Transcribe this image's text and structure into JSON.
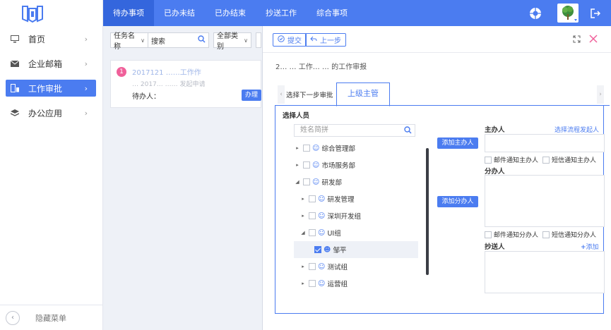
{
  "sidebar": {
    "items": [
      {
        "label": "首页",
        "icon": "monitor-icon"
      },
      {
        "label": "企业邮箱",
        "icon": "mail-icon"
      },
      {
        "label": "工作审批",
        "icon": "approval-icon"
      },
      {
        "label": "办公应用",
        "icon": "layers-icon"
      }
    ],
    "collapse_label": "隐藏菜单"
  },
  "topbar": {
    "tabs": [
      "待办事项",
      "已办未结",
      "已办结束",
      "抄送工作",
      "综合事项"
    ]
  },
  "list": {
    "filter_select": "任务名称",
    "search_placeholder": "搜索",
    "category_select": "全部类别",
    "card": {
      "index": "1",
      "title": "2017121 ……工作作",
      "subtitle": "… 2017… …… 发起申请",
      "owner_label": "待办人：",
      "handle_button": "办理"
    }
  },
  "panel": {
    "submit_label": "提交",
    "prev_label": "上一步",
    "doc_title": "2… … 工作…     … 的工作审报",
    "step_label": "选择下一步审批",
    "step_tab": "上级主管",
    "select_title": "选择人员",
    "search_placeholder": "姓名简拼",
    "tree": [
      {
        "label": "综合管理部",
        "level": 0,
        "arrow": "▸"
      },
      {
        "label": "市场服务部",
        "level": 0,
        "arrow": "▸"
      },
      {
        "label": "研发部",
        "level": 0,
        "arrow": "◂"
      },
      {
        "label": "研发管理",
        "level": 1,
        "arrow": "▸"
      },
      {
        "label": "深圳开发组",
        "level": 1,
        "arrow": "▸"
      },
      {
        "label": "UI组",
        "level": 1,
        "arrow": "◂"
      },
      {
        "label": "邹平",
        "level": 2,
        "arrow": "",
        "checked": true
      },
      {
        "label": "测试组",
        "level": 1,
        "arrow": "▸"
      },
      {
        "label": "运营组",
        "level": 1,
        "arrow": "▸"
      }
    ],
    "add_main_button": "添加主办人",
    "add_sub_button": "添加分办人",
    "main_label": "主办人",
    "select_initiator_link": "选择流程发起人",
    "mail_notify_main": "邮件通知主办人",
    "sms_notify_main": "短信通知主办人",
    "sub_label": "分办人",
    "mail_notify_sub": "邮件通知分办人",
    "sms_notify_sub": "短信通知分办人",
    "cc_label": "抄送人",
    "add_cc_link": "添加"
  },
  "colors": {
    "accent": "#4b7cf0",
    "accent_dark": "#3466dd",
    "badge": "#f0609a"
  }
}
